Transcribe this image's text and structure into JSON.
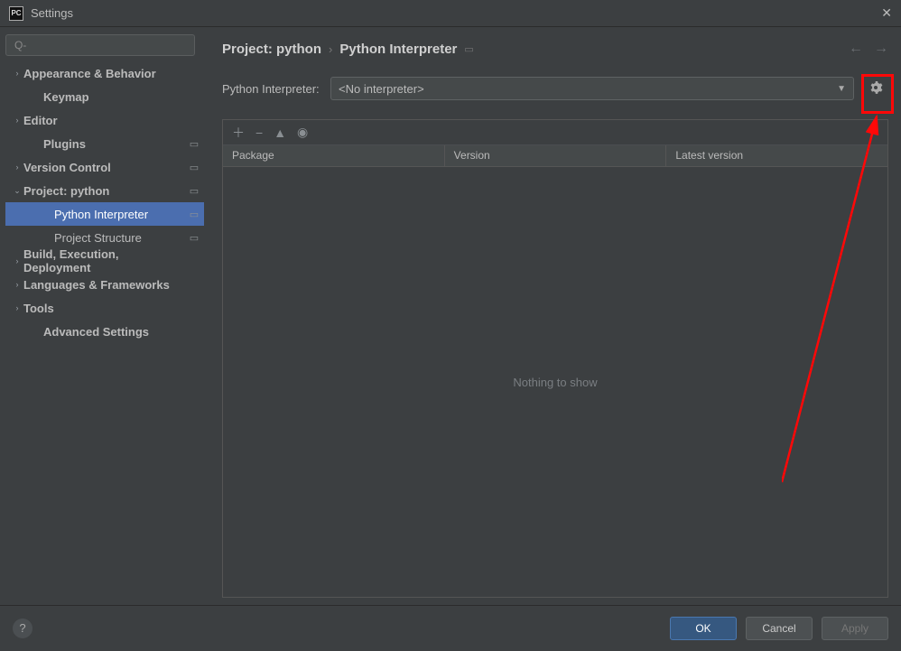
{
  "window": {
    "title": "Settings"
  },
  "search": {
    "placeholder": ""
  },
  "sidebar": {
    "items": [
      {
        "label": "Appearance & Behavior",
        "caret": "›",
        "bold": true
      },
      {
        "label": "Keymap",
        "indent": 1,
        "bold": true
      },
      {
        "label": "Editor",
        "caret": "›",
        "bold": true
      },
      {
        "label": "Plugins",
        "badge": "▭",
        "indent": 1,
        "bold": true
      },
      {
        "label": "Version Control",
        "caret": "›",
        "badge": "▭",
        "bold": true
      },
      {
        "label": "Project: python",
        "caret": "⌄",
        "badge": "▭",
        "bold": true
      },
      {
        "label": "Python Interpreter",
        "indent": 2,
        "badge": "▭",
        "selected": true
      },
      {
        "label": "Project Structure",
        "indent": 2,
        "badge": "▭"
      },
      {
        "label": "Build, Execution, Deployment",
        "caret": "›",
        "bold": true
      },
      {
        "label": "Languages & Frameworks",
        "caret": "›",
        "bold": true
      },
      {
        "label": "Tools",
        "caret": "›",
        "bold": true
      },
      {
        "label": "Advanced Settings",
        "indent": 1,
        "bold": true
      }
    ]
  },
  "breadcrumb": {
    "project": "Project: python",
    "page": "Python Interpreter"
  },
  "interpreter": {
    "label": "Python Interpreter:",
    "value": "<No interpreter>"
  },
  "packages": {
    "cols": {
      "package": "Package",
      "version": "Version",
      "latest": "Latest version"
    },
    "empty": "Nothing to show"
  },
  "buttons": {
    "ok": "OK",
    "cancel": "Cancel",
    "apply": "Apply"
  }
}
